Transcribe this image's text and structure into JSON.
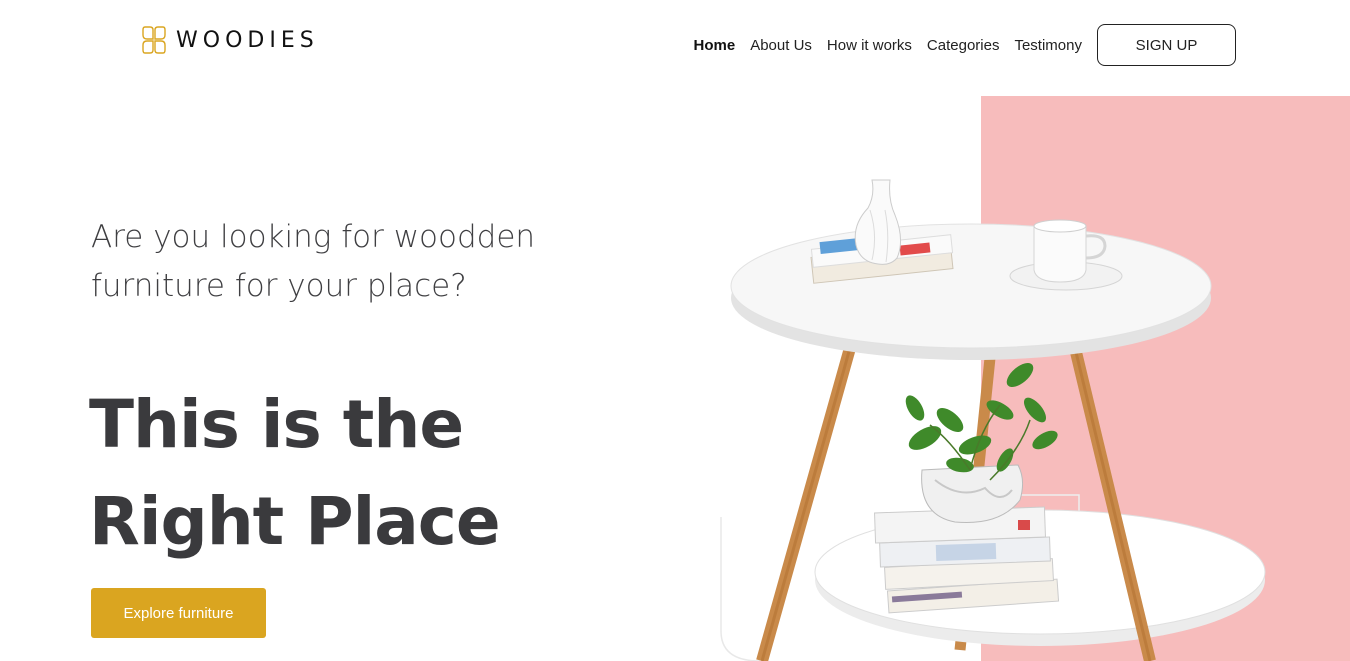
{
  "brand": {
    "name": "WOODIES",
    "logo_icon": "four-petal-logo-icon",
    "accent": "#daa520"
  },
  "nav": {
    "items": [
      {
        "label": "Home",
        "active": true
      },
      {
        "label": "About Us",
        "active": false
      },
      {
        "label": "How it works",
        "active": false
      },
      {
        "label": "Categories",
        "active": false
      },
      {
        "label": "Testimony",
        "active": false
      }
    ],
    "signup_label": "SIGN UP"
  },
  "hero": {
    "subtitle": "Are you looking for woodden furniture for your place?",
    "title_line1": "This is the",
    "title_line2": "Right Place",
    "cta_label": "Explore furniture",
    "pink_color": "#f7bcbc",
    "cta_color": "#daa520"
  },
  "image": {
    "subject": "round-side-table-with-vase-books-cup-and-plant"
  }
}
